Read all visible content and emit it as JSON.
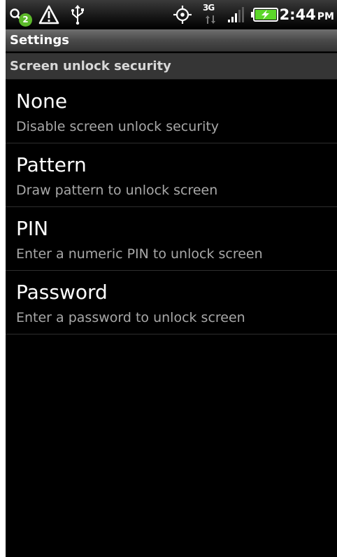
{
  "status_bar": {
    "icons": [
      "search-icon",
      "warning-icon",
      "usb-icon",
      "gps-icon",
      "network-3g-icon",
      "signal-icon",
      "battery-charging-icon"
    ],
    "notification_count": "2",
    "network_label": "3G",
    "time": "2:44",
    "ampm": "PM"
  },
  "title_bar": {
    "title": "Settings"
  },
  "section": {
    "header": "Screen unlock security"
  },
  "options": [
    {
      "title": "None",
      "summary": "Disable screen unlock security"
    },
    {
      "title": "Pattern",
      "summary": "Draw pattern to unlock screen"
    },
    {
      "title": "PIN",
      "summary": "Enter a numeric PIN to unlock screen"
    },
    {
      "title": "Password",
      "summary": "Enter a password to unlock screen"
    }
  ],
  "colors": {
    "background": "#000000",
    "divider": "#2e2e2e",
    "summary_text": "#a8a8a8",
    "notification_badge": "#5cb92a",
    "battery_charge": "#5cd62a"
  }
}
